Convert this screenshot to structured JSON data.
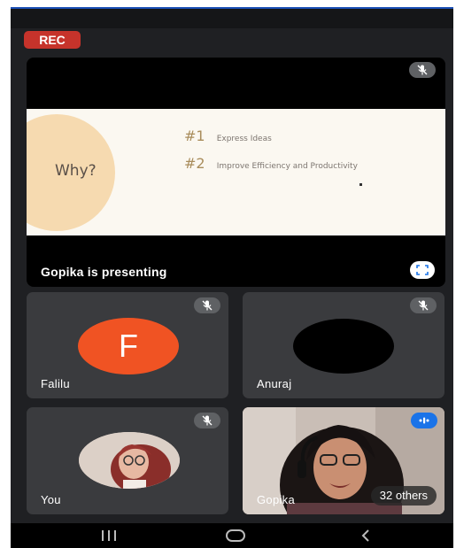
{
  "recording": {
    "label": "REC"
  },
  "presentation": {
    "presenter_text": "Gopika is presenting",
    "slide": {
      "title": "Why?",
      "points": [
        {
          "number": "#1",
          "text": "Express Ideas"
        },
        {
          "number": "#2",
          "text": "Improve Efficiency and Productivity"
        }
      ]
    },
    "mic_icon": "mic-off-icon",
    "fullscreen_icon": "fullscreen-icon"
  },
  "participants": [
    {
      "name": "Falilu",
      "avatar_letter": "F",
      "avatar_color": "#f05323",
      "muted": true
    },
    {
      "name": "Anuraj",
      "avatar_color": "#000000",
      "muted": true
    },
    {
      "name": "You",
      "muted": true
    },
    {
      "name": "Gopika",
      "speaking": true
    }
  ],
  "others_count_label": "32 others",
  "nav": [
    "recent-apps-icon",
    "home-icon",
    "back-icon"
  ],
  "colors": {
    "rec_red": "#c6332b",
    "avatar_orange": "#f05323",
    "speaking_blue": "#1a73e8",
    "background": "#1f2023",
    "tile": "#3a3b3e"
  }
}
